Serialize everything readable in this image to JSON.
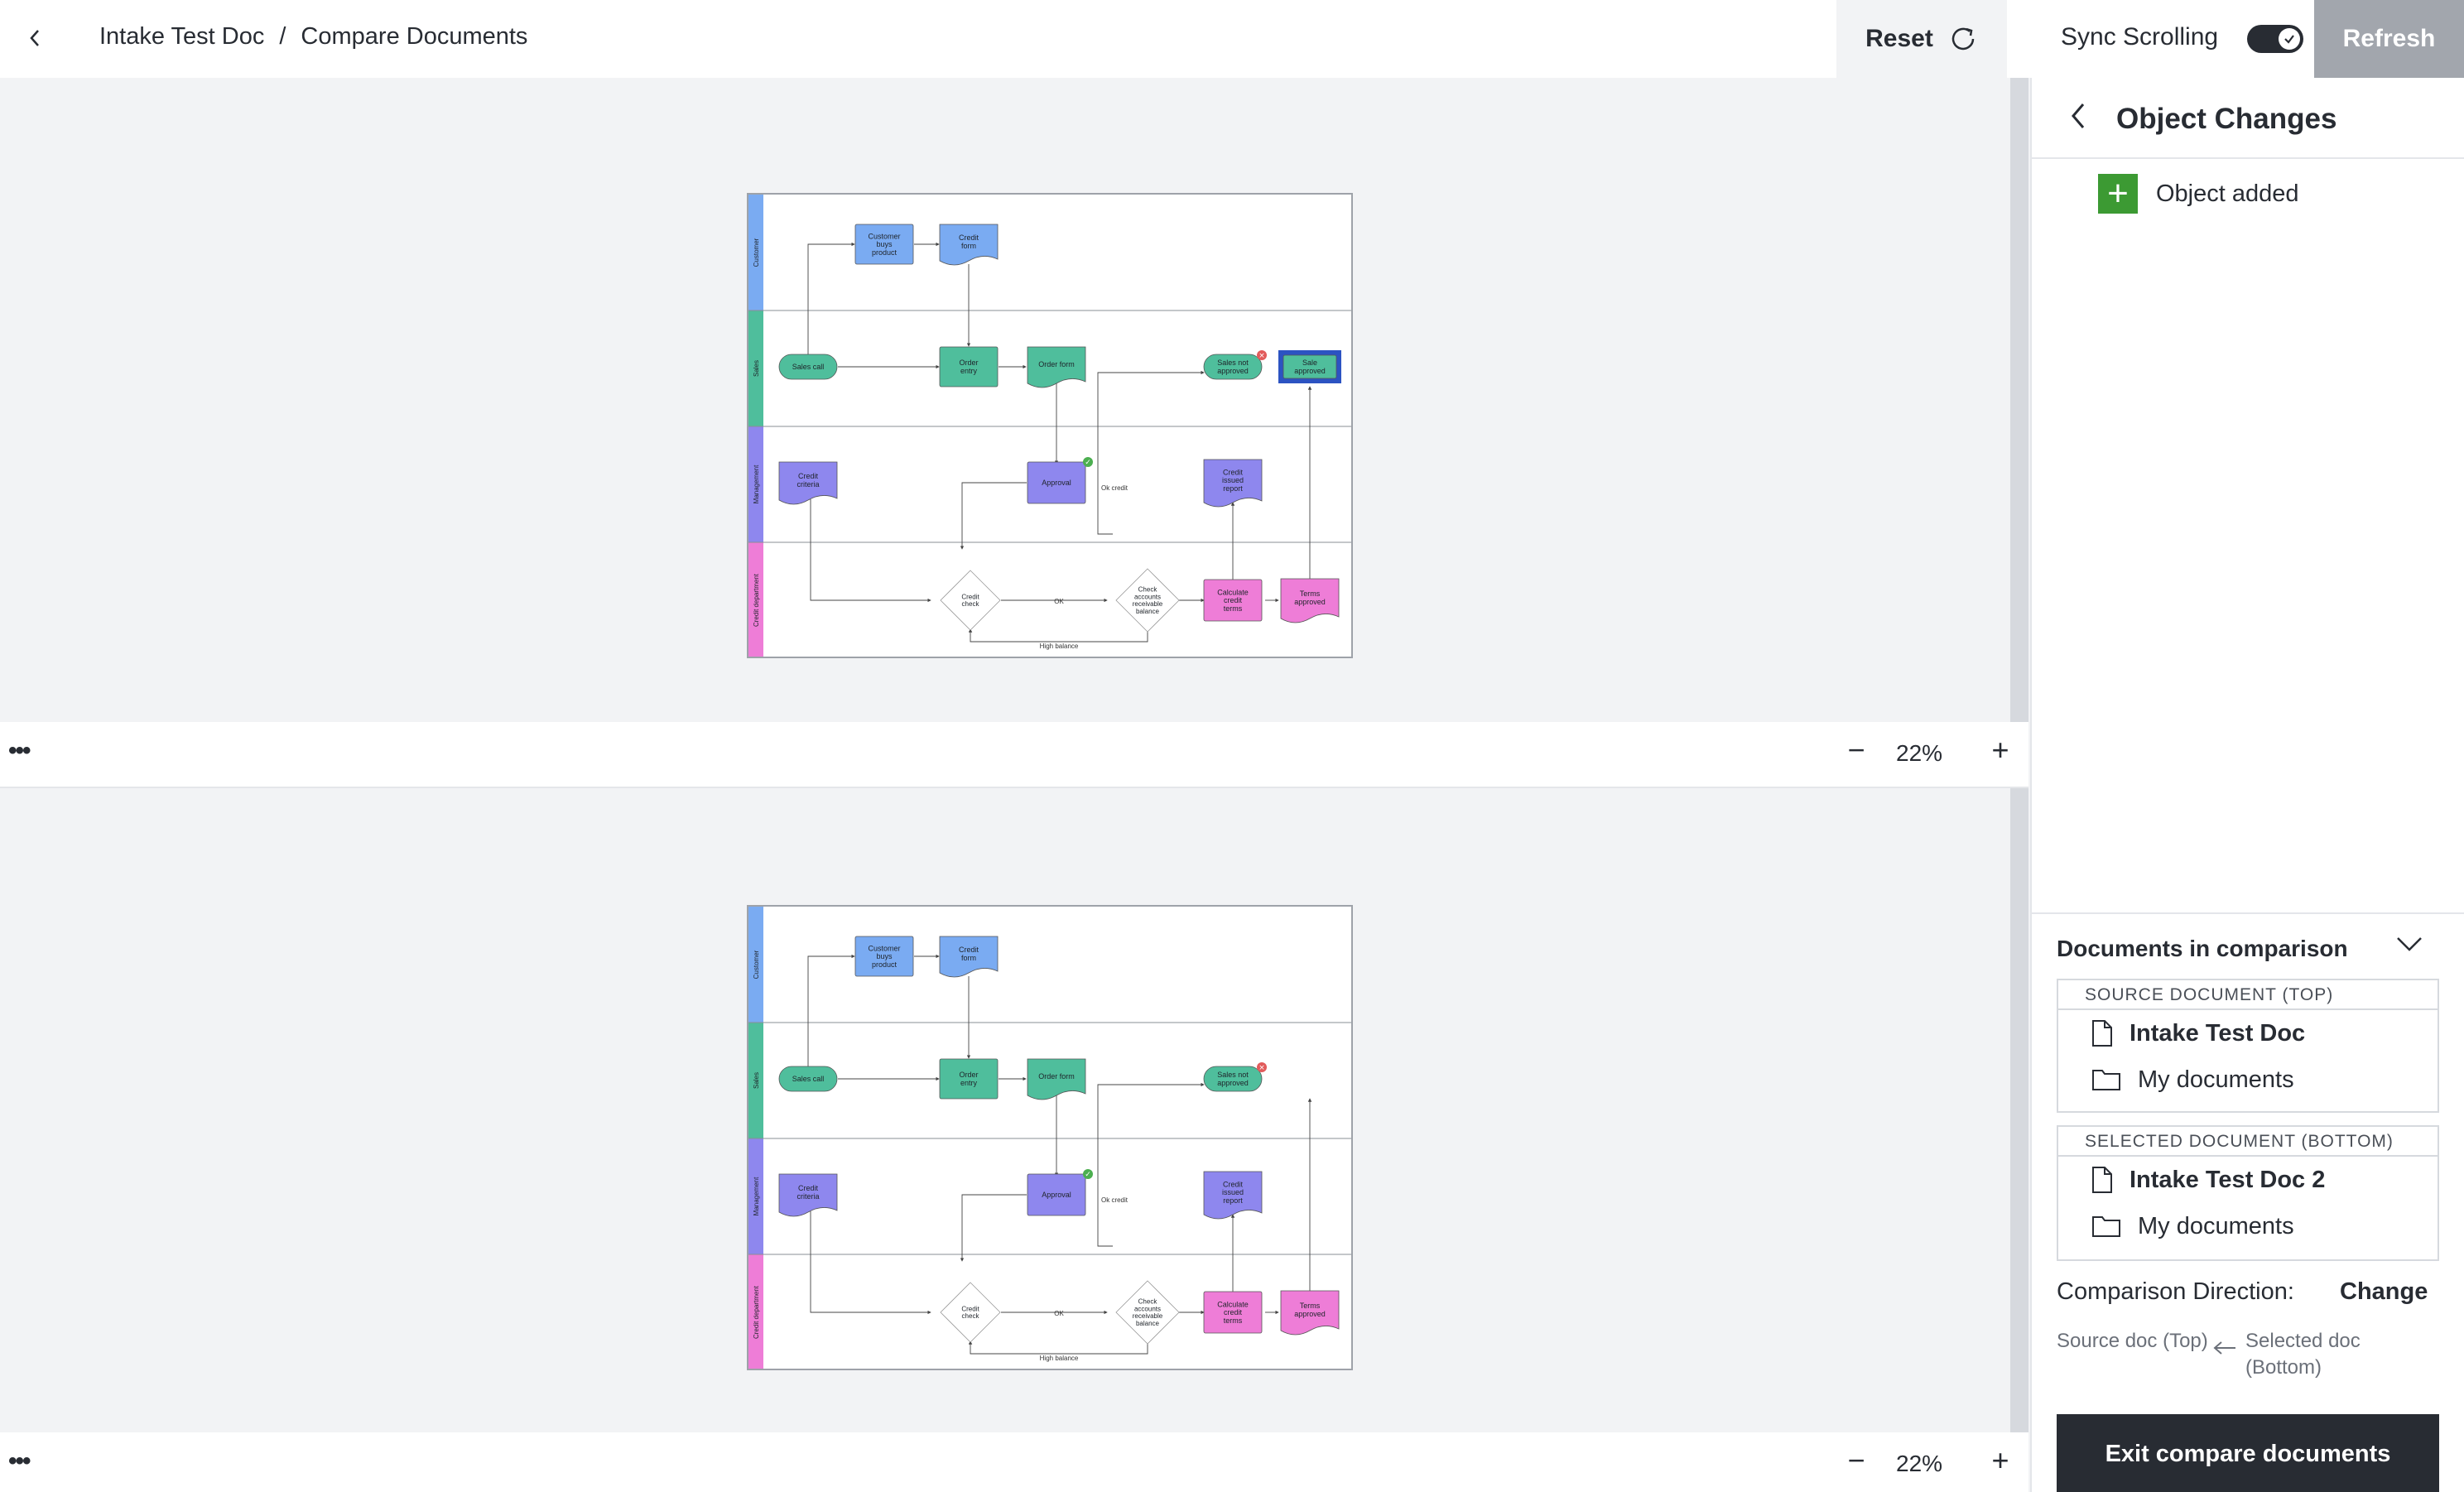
{
  "header": {
    "breadcrumb": [
      "Intake Test Doc",
      "Compare Documents"
    ],
    "separator": "/",
    "reset_label": "Reset",
    "sync_label": "Sync Scrolling",
    "sync_enabled": true,
    "refresh_label": "Refresh"
  },
  "viewer": {
    "top_zoom": "22%",
    "bottom_zoom": "22%",
    "more_label": "•••"
  },
  "diagram": {
    "lanes": [
      "Customer",
      "Sales",
      "Management",
      "Credit department"
    ],
    "lane_colors": [
      "#7aabf2",
      "#4fbe9c",
      "#8e87ee",
      "#ee7dd7"
    ],
    "shapes": {
      "customer_buys": "Customer buys product",
      "credit_form": "Credit form",
      "sales_call": "Sales call",
      "order_entry": "Order entry",
      "order_form": "Order form",
      "sales_not_approved": "Sales not approved",
      "sale_approved": "Sale approved",
      "credit_criteria": "Credit criteria",
      "approval": "Approval",
      "credit_issued_report": "Credit issued report",
      "credit_check": "Credit check",
      "check_accounts": "Check accounts receivable balance",
      "calculate_terms": "Calculate credit terms",
      "terms_approved": "Terms approved",
      "ok": "OK",
      "high_balance": "High balance",
      "ok_credit": "Ok credit"
    }
  },
  "panel": {
    "title": "Object Changes",
    "changes": [
      {
        "type": "added",
        "label": "Object added",
        "icon": "plus-icon",
        "color": "#3c9a33"
      }
    ],
    "docs_heading": "Documents in comparison",
    "source": {
      "label": "SOURCE DOCUMENT (TOP)",
      "name": "Intake Test Doc",
      "folder": "My documents"
    },
    "selected": {
      "label": "SELECTED DOCUMENT (BOTTOM)",
      "name": "Intake Test Doc 2",
      "folder": "My documents"
    },
    "direction_label": "Comparison Direction:",
    "direction_change": "Change",
    "direction_from": "Source doc (Top)",
    "direction_to": "Selected doc (Bottom)",
    "exit_label": "Exit compare documents"
  }
}
